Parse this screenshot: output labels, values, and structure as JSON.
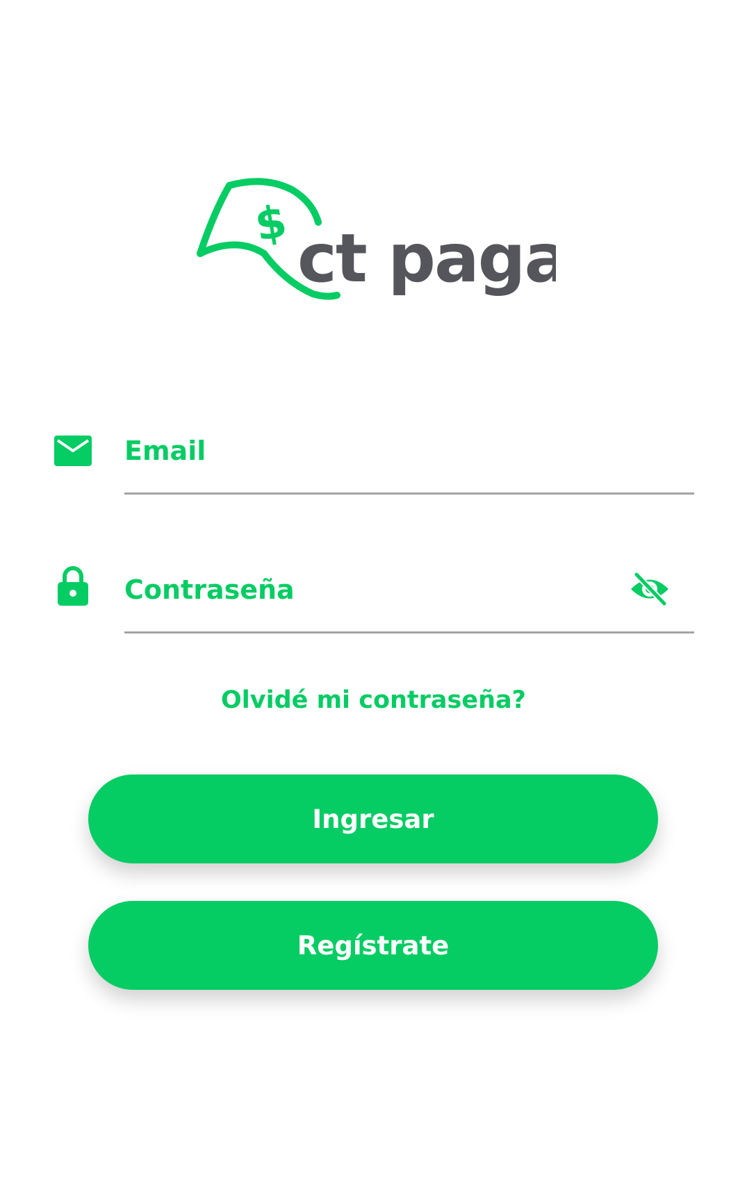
{
  "brand": {
    "logo_text": "ct paga",
    "logo_symbol": "$",
    "primary_color": "#05cc63",
    "logo_text_color": "#55565c",
    "line_color": "#a3a3a3"
  },
  "email_field": {
    "icon": "envelope-icon",
    "placeholder": "Email"
  },
  "password_field": {
    "icon": "lock-icon",
    "placeholder": "Contraseña",
    "visibility_icon": "eye-off-icon"
  },
  "forgot_password_label": "Olvidé mi contraseña?",
  "login_button_label": "Ingresar",
  "register_button_label": "Regístrate"
}
